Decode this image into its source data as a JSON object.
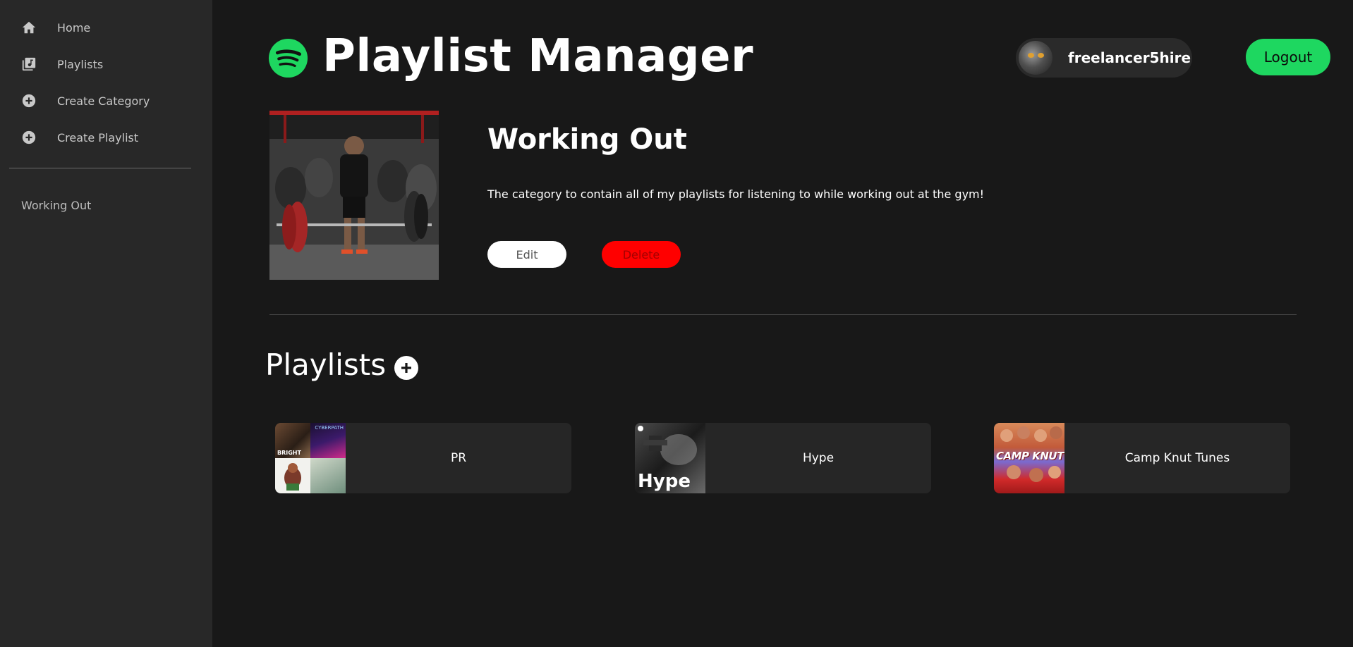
{
  "sidebar": {
    "nav_items": [
      {
        "label": "Home",
        "icon": "home-icon"
      },
      {
        "label": "Playlists",
        "icon": "library-music-icon"
      },
      {
        "label": "Create Category",
        "icon": "plus-circle-icon"
      },
      {
        "label": "Create Playlist",
        "icon": "plus-circle-icon"
      }
    ],
    "categories": [
      "Working Out"
    ]
  },
  "header": {
    "title": "Playlist Manager",
    "username": "freelancer5hire",
    "logout_label": "Logout"
  },
  "category": {
    "title": "Working Out",
    "description": "The category to contain all of my playlists for listening to while working out at the gym!",
    "edit_label": "Edit",
    "delete_label": "Delete"
  },
  "playlists": {
    "heading": "Playlists",
    "items": [
      {
        "name": "PR"
      },
      {
        "name": "Hype"
      },
      {
        "name": "Camp Knut Tunes"
      }
    ],
    "cover_text": {
      "pr_tile_1": "BRIGHT",
      "pr_tile_2": "CYBERPATH",
      "hype": "Hype",
      "camp": "CAMP KNUT"
    }
  },
  "colors": {
    "accent": "#1ed760",
    "danger": "#ff0000",
    "background": "#181818",
    "sidebar": "#282828",
    "card": "#262626"
  }
}
